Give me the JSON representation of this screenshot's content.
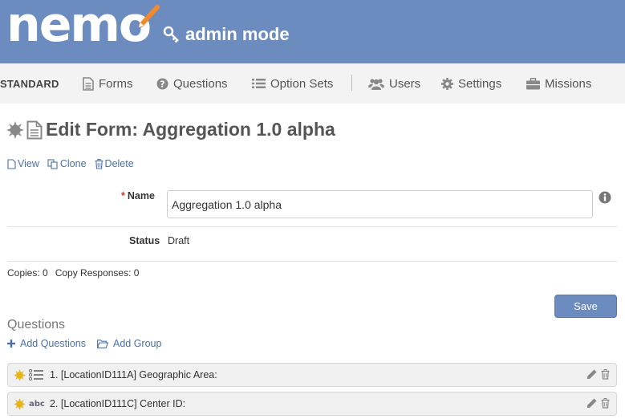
{
  "header": {
    "logo_text": "nemo",
    "mode_text": "admin mode"
  },
  "nav": {
    "mode_label": "STANDARD",
    "items": [
      {
        "label": "Forms",
        "icon": "file-icon"
      },
      {
        "label": "Questions",
        "icon": "question-circle-icon"
      },
      {
        "label": "Option Sets",
        "icon": "list-icon"
      },
      {
        "label": "Users",
        "icon": "users-icon"
      },
      {
        "label": "Settings",
        "icon": "gear-icon"
      },
      {
        "label": "Missions",
        "icon": "briefcase-icon"
      }
    ]
  },
  "page": {
    "title": "Edit Form: Aggregation 1.0 alpha",
    "actions": {
      "view": "View",
      "clone": "Clone",
      "delete": "Delete"
    }
  },
  "form": {
    "name_label": "Name",
    "required_marker": "*",
    "name_value": "Aggregation 1.0 alpha",
    "status_label": "Status",
    "status_value": "Draft",
    "copies_text": "Copies: 0",
    "copy_responses_text": "Copy Responses: 0",
    "save_label": "Save"
  },
  "questions": {
    "heading": "Questions",
    "add_questions": "Add Questions",
    "add_group": "Add Group",
    "type_abc": "abc",
    "items": [
      {
        "text": "1. [LocationID111A] Geographic Area:",
        "type_icon": "select-list-icon"
      },
      {
        "text": "2. [LocationID111C] Center ID:",
        "type_icon": "text-abc-icon"
      }
    ]
  },
  "colors": {
    "brand": "#6c8bbf",
    "link": "#4a70aa",
    "sun": "#e7b21a",
    "pencil": "#f08a2c"
  }
}
